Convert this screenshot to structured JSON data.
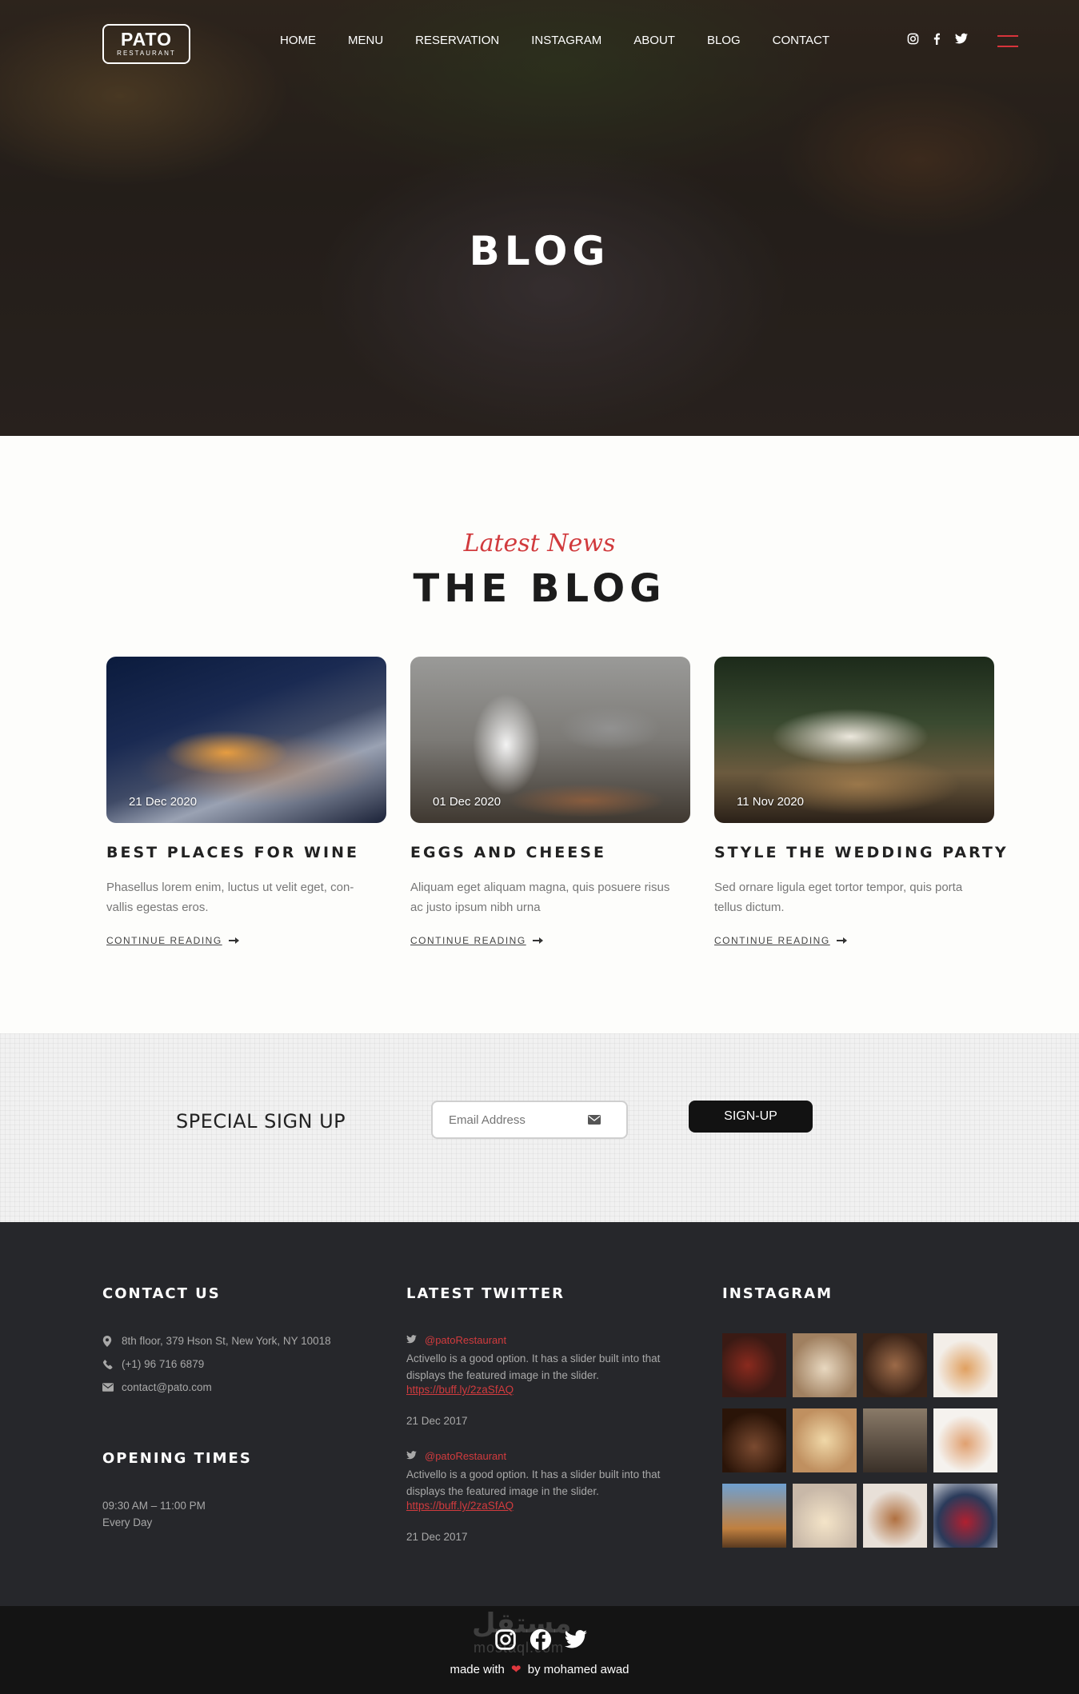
{
  "header": {
    "logo_main": "PATO",
    "logo_sub": "RESTAURANT",
    "nav": [
      "HOME",
      "MENU",
      "RESERVATION",
      "INSTAGRAM",
      "ABOUT",
      "BLOG",
      "CONTACT"
    ],
    "social_icons": [
      "instagram-icon",
      "facebook-icon",
      "twitter-icon"
    ],
    "hamburger_color": "#d8343b"
  },
  "hero": {
    "title": "BLOG"
  },
  "blog": {
    "eyebrow": "Latest News",
    "title": "THE BLOG",
    "cards": [
      {
        "date": "21 Dec 2020",
        "title": "BEST PLACES FOR WINE",
        "text": "Phasellus lorem enim, luctus ut velit eget, con-vallis egestas eros.",
        "link": "CONTINUE READING"
      },
      {
        "date": "01 Dec 2020",
        "title": "EGGS AND CHEESE",
        "text": "Aliquam eget aliquam magna, quis posuere risus ac justo ipsum nibh urna",
        "link": "CONTINUE READING"
      },
      {
        "date": "11 Nov 2020",
        "title": "STYLE THE WEDDING PARTY",
        "text": "Sed ornare ligula eget tortor tempor, quis porta tellus dictum.",
        "link": "CONTINUE READING"
      }
    ]
  },
  "signup": {
    "title": "SPECIAL SIGN UP",
    "email_placeholder": "Email Address",
    "button": "SIGN-UP"
  },
  "footer": {
    "contact_title": "CONTACT US",
    "address": "8th floor, 379 Hson St, New York, NY 10018",
    "phone": "(+1) 96 716 6879",
    "email": "contact@pato.com",
    "opening_title": "OPENING TIMES",
    "hours": "09:30 AM – 11:00 PM",
    "days": "Every Day",
    "twitter_title": "LATEST TWITTER",
    "tweets": [
      {
        "handle": "@patoRestaurant",
        "text": "Activello is a good option. It has a slider built into that displays the featured image in the slider.",
        "link": "https://buff.ly/2zaSfAQ",
        "date": "21 Dec 2017"
      },
      {
        "handle": "@patoRestaurant",
        "text": "Activello is a good option. It has a slider built into that displays the featured image in the slider.",
        "link": "https://buff.ly/2zaSfAQ",
        "date": "21 Dec 2017"
      }
    ],
    "instagram_title": "INSTAGRAM",
    "accent": "#d23b3e"
  },
  "bottom": {
    "made_with": "made with",
    "by": "by mohamed awad",
    "watermark": "مستقل",
    "watermark_domain": "mostaql.com"
  }
}
